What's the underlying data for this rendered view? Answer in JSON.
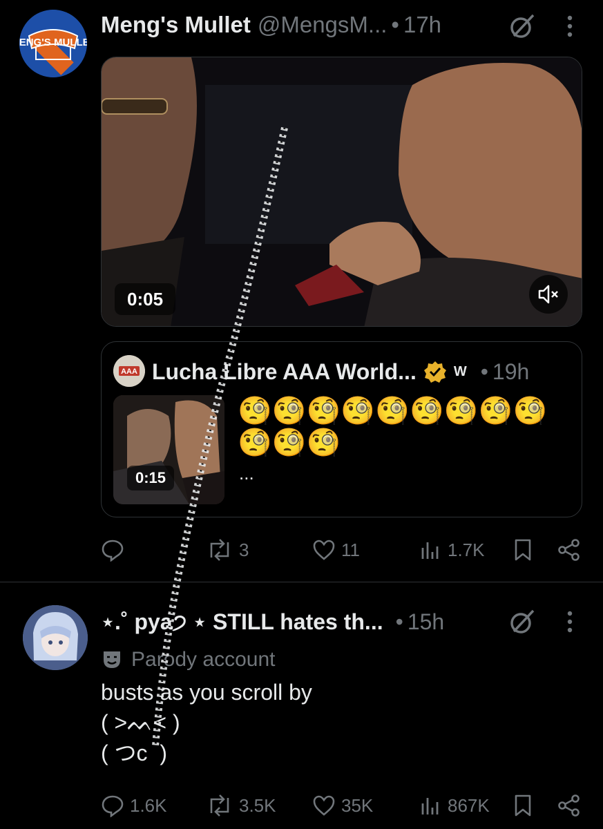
{
  "tweet1": {
    "name": "Meng's Mullet",
    "handle": "@MengsM...",
    "time": "17h",
    "avatar_text": "MENG'S MULLET",
    "video": {
      "duration": "0:05"
    },
    "quote": {
      "name": "Lucha Libre AAA World...",
      "wwe_badge": "W",
      "time": "19h",
      "video_duration": "0:15",
      "text": "🧐🧐🧐🧐🧐🧐🧐🧐🧐🧐🧐🧐",
      "ellipsis": "..."
    },
    "actions": {
      "reply": "",
      "retweets": "3",
      "likes": "11",
      "views": "1.7K"
    }
  },
  "tweet2": {
    "name": "⋆.˚ pya੭ ⋆ STILL hates th...",
    "time": "15h",
    "parody_label": "Parody account",
    "body": "busts as you scroll by\n( >ᨓ< )\n( つc  )",
    "actions": {
      "replies": "1.6K",
      "retweets": "3.5K",
      "likes": "35K",
      "views": "867K"
    }
  },
  "separator": "•",
  "colors": {
    "background": "#000000",
    "text": "#e7e9ea",
    "muted": "#71767b",
    "border": "#2f3336",
    "verified": "#e8b22b"
  }
}
